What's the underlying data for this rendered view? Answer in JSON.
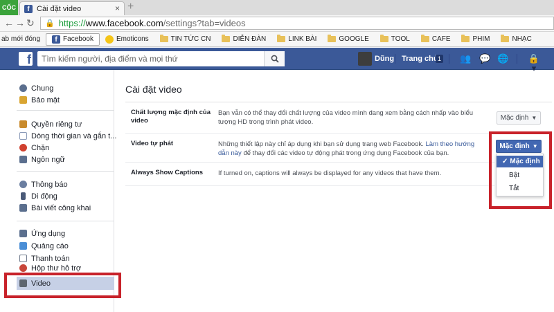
{
  "browser": {
    "brand": "CỐC",
    "tab_title": "Cài đặt video",
    "tab_close": "×",
    "new_tab": "+",
    "url_scheme": "https://",
    "url_host": "www.facebook.com",
    "url_path": "/settings?tab=videos",
    "bookmarks": [
      {
        "label": "ab mới đóng",
        "icon": "none"
      },
      {
        "label": "Facebook",
        "icon": "facebook-icon"
      },
      {
        "label": "Emoticons",
        "icon": "emoticon-icon"
      },
      {
        "label": "TIN TỨC CN",
        "icon": "folder-icon"
      },
      {
        "label": "DIỄN ĐÀN",
        "icon": "folder-icon"
      },
      {
        "label": "LINK BÀI",
        "icon": "folder-icon"
      },
      {
        "label": "GOOGLE",
        "icon": "folder-icon"
      },
      {
        "label": "TOOL",
        "icon": "folder-icon"
      },
      {
        "label": "CAFE",
        "icon": "folder-icon"
      },
      {
        "label": "PHIM",
        "icon": "folder-icon"
      },
      {
        "label": "NHẠC",
        "icon": "folder-icon"
      }
    ]
  },
  "topbar": {
    "logo": "f",
    "search_placeholder": "Tìm kiếm người, địa điểm và mọi thứ",
    "user_name": "Dũng",
    "home_label": "Trang chủ",
    "home_badge": "1"
  },
  "sidebar": {
    "groups": [
      [
        {
          "label": "Chung",
          "icon": "gear-icon",
          "color": "#5b6f8e"
        },
        {
          "label": "Bảo mật",
          "icon": "lock-icon",
          "color": "#d9a531"
        }
      ],
      [
        {
          "label": "Quyền riêng tư",
          "icon": "privacy-icon",
          "color": "#c98b2d"
        },
        {
          "label": "Dòng thời gian và gắn t...",
          "icon": "timeline-icon",
          "color": "#8a9ab8"
        },
        {
          "label": "Chặn",
          "icon": "block-icon",
          "color": "#d0412f"
        },
        {
          "label": "Ngôn ngữ",
          "icon": "language-icon",
          "color": "#5b6f8e"
        }
      ],
      [
        {
          "label": "Thông báo",
          "icon": "globe-icon",
          "color": "#6a7ea0"
        },
        {
          "label": "Di động",
          "icon": "mobile-icon",
          "color": "#4a5a78"
        },
        {
          "label": "Bài viết công khai",
          "icon": "rss-icon",
          "color": "#5b6f8e"
        }
      ],
      [
        {
          "label": "Ứng dụng",
          "icon": "apps-icon",
          "color": "#5b6f8e"
        },
        {
          "label": "Quảng cáo",
          "icon": "ads-icon",
          "color": "#4a8ed6"
        },
        {
          "label": "Thanh toán",
          "icon": "payment-icon",
          "color": "#6f7a8c"
        },
        {
          "label": "Hộp thư hỗ trợ",
          "icon": "support-icon",
          "color": "#c8463a"
        },
        {
          "label": "Video",
          "icon": "video-icon",
          "color": "#5e6670"
        }
      ]
    ]
  },
  "main": {
    "title": "Cài đặt video",
    "rows": [
      {
        "label": [
          "Chất lượng mặc định của",
          "video"
        ],
        "desc": [
          "Bạn vẫn có thể thay đổi chất lượng của video mình đang xem bằng cách nhấp vào biểu",
          "tượng HD trong trình phát video."
        ],
        "button": "Mặc định"
      },
      {
        "label": [
          "Video tự phát"
        ],
        "desc_1": "Những thiết lập này chỉ áp dụng khi bạn sử dụng trang web Facebook. ",
        "desc_link_1": "Làm theo hướng",
        "desc_link_2": "dẫn này",
        "desc_2": " để thay đổi các video tự động phát trong ứng dụng Facebook của bạn.",
        "button": "Mặc định"
      },
      {
        "label": [
          "Always Show Captions"
        ],
        "desc": [
          "If turned on, captions will always be displayed for any videos that have them."
        ]
      }
    ],
    "dropdown": {
      "options": [
        "Mặc định",
        "Bật",
        "Tắt"
      ],
      "selected": "Mặc định",
      "check": "✓"
    }
  },
  "colors": {
    "facebook_blue": "#3b5998",
    "button_blue": "#4267b2",
    "annotation_red": "#c8222a"
  }
}
